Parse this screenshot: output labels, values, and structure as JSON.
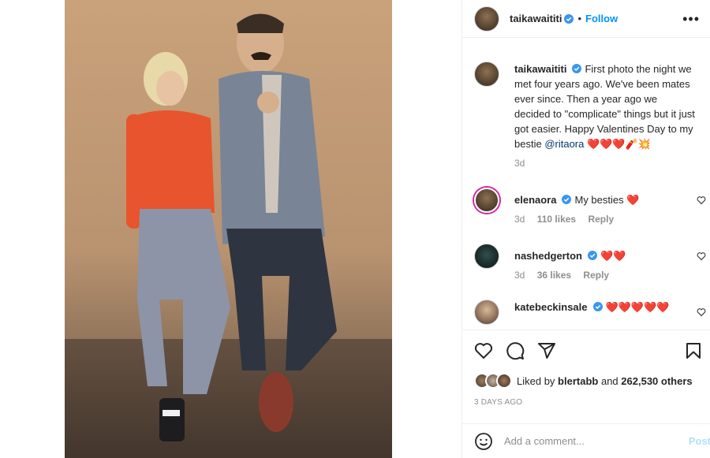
{
  "post": {
    "username": "taikawaititi",
    "verified_icon": "verified-badge-icon",
    "separator": "•",
    "follow_label": "Follow",
    "more_label": "•••",
    "caption": "First photo the night we met four years ago. We've been mates ever since. Then a year ago we decided to \"complicate\" things but it just got easier. Happy Valentines Day to my bestie ",
    "caption_mention": "@ritaora",
    "caption_emoji": "❤️❤️❤️🧨💥",
    "caption_age": "3d"
  },
  "comments": [
    {
      "username": "elenaora",
      "text": "My besties",
      "emoji": "❤️",
      "age": "3d",
      "likes": "110 likes",
      "reply": "Reply"
    },
    {
      "username": "nashedgerton",
      "text": "",
      "emoji": "❤️❤️",
      "age": "3d",
      "likes": "36 likes",
      "reply": "Reply"
    },
    {
      "username": "katebeckinsale",
      "text": "",
      "emoji": "❤️❤️❤️❤️❤️"
    }
  ],
  "likes": {
    "prefix": "Liked by",
    "user": "blertabb",
    "and": "and",
    "count": "262,530 others"
  },
  "timestamp": "3 DAYS AGO",
  "add_comment": {
    "placeholder": "Add a comment...",
    "post_label": "Post"
  },
  "colors": {
    "accent": "#0095f6",
    "text": "#262626",
    "muted": "#8e8e8e",
    "heart": "#ed4956"
  }
}
